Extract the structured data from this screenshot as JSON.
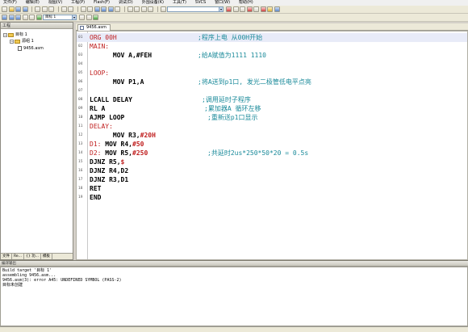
{
  "menu": [
    "文件(F)",
    "编辑(E)",
    "视图(V)",
    "工程(P)",
    "Flash(F)",
    "调试(D)",
    "外围设备(K)",
    "工具(T)",
    "SVCS",
    "窗口(W)",
    "帮助(H)"
  ],
  "project_panel": {
    "title": "工程",
    "target": "目标 1",
    "group": "源组 1",
    "file": "9456.asm",
    "tabs": [
      "文件",
      "Re...",
      "{} 功...",
      "模板"
    ]
  },
  "toolbar": {
    "target_combo": "目标 1"
  },
  "editor": {
    "tab_label": "9456.asm",
    "lines": [
      {
        "n": "01",
        "parts": [
          {
            "t": "ORG ",
            "c": "label"
          },
          {
            "t": "00H",
            "c": "label"
          }
        ],
        "comment": ";程序上电 从00H开始"
      },
      {
        "n": "02",
        "parts": [
          {
            "t": "MAIN:",
            "c": "label"
          }
        ],
        "comment": ""
      },
      {
        "n": "03",
        "parts": [
          {
            "t": "      MOV A,#FEH",
            "c": ""
          }
        ],
        "comment": ";给A赋值为1111 1110"
      },
      {
        "n": "04",
        "parts": [],
        "comment": ""
      },
      {
        "n": "05",
        "parts": [
          {
            "t": "LOOP:",
            "c": "label"
          }
        ],
        "comment": ""
      },
      {
        "n": "06",
        "parts": [
          {
            "t": "      MOV P1,A",
            "c": ""
          }
        ],
        "comment": ";将A送到p1口, 发光二极管低电平点亮"
      },
      {
        "n": "07",
        "parts": [],
        "comment": ""
      },
      {
        "n": "08",
        "parts": [
          {
            "t": "LCALL DELAY",
            "c": ""
          }
        ],
        "comment": ";调用延时子程序"
      },
      {
        "n": "09",
        "parts": [
          {
            "t": "RL A",
            "c": ""
          }
        ],
        "comment": ";累加器A 循环左移"
      },
      {
        "n": "10",
        "parts": [
          {
            "t": "AJMP LOOP",
            "c": ""
          }
        ],
        "comment": ";重新送p1口显示"
      },
      {
        "n": "11",
        "parts": [
          {
            "t": "DELAY:",
            "c": "label"
          }
        ],
        "comment": ""
      },
      {
        "n": "12",
        "parts": [
          {
            "t": "      MOV R3,",
            "c": ""
          },
          {
            "t": "#20H",
            "c": "num"
          }
        ],
        "comment": ""
      },
      {
        "n": "13",
        "parts": [
          {
            "t": "D1:",
            "c": "label"
          },
          {
            "t": " MOV R4,",
            "c": ""
          },
          {
            "t": "#50",
            "c": "num"
          }
        ],
        "comment": ""
      },
      {
        "n": "14",
        "parts": [
          {
            "t": "D2:",
            "c": "label"
          },
          {
            "t": " MOV R5,",
            "c": ""
          },
          {
            "t": "#250",
            "c": "num"
          }
        ],
        "comment": ";共延时2us*250*50*20 = 0.5s"
      },
      {
        "n": "15",
        "parts": [
          {
            "t": "DJNZ R5,",
            "c": ""
          },
          {
            "t": "$",
            "c": "num"
          }
        ],
        "comment": ""
      },
      {
        "n": "16",
        "parts": [
          {
            "t": "DJNZ R4,D2",
            "c": ""
          }
        ],
        "comment": ""
      },
      {
        "n": "17",
        "parts": [
          {
            "t": "DJNZ R3,D1",
            "c": ""
          }
        ],
        "comment": ""
      },
      {
        "n": "18",
        "parts": [
          {
            "t": "RET",
            "c": ""
          }
        ],
        "comment": ""
      },
      {
        "n": "19",
        "parts": [
          {
            "t": "END",
            "c": ""
          }
        ],
        "comment": ""
      }
    ]
  },
  "output": {
    "title": "编译输出",
    "lines": [
      "Build target '目标 1'",
      "assembling 9456.asm...",
      "9456.asm(3): error A45: UNDEFINED SYMBOL (PASS-2)",
      "目标未创建"
    ]
  }
}
